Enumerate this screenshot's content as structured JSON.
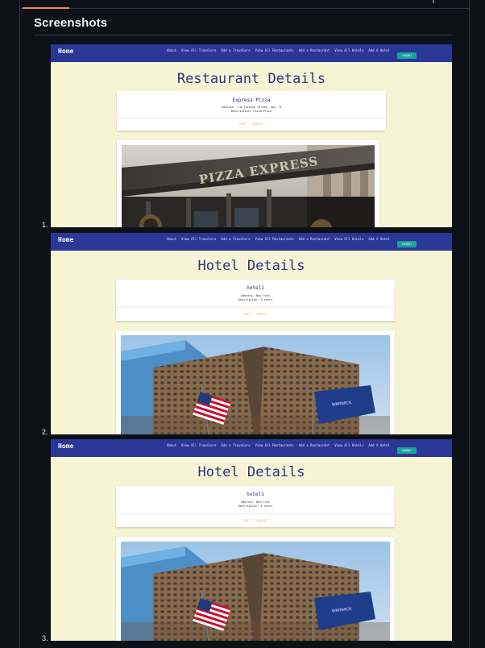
{
  "section": {
    "title": "Screenshots"
  },
  "shots": [
    {
      "number": "1.",
      "nav": {
        "home": "Home",
        "links": [
          "About",
          "View All Travelers",
          "Add a Travelers",
          "View All Restaurants",
          "Add a Restaurant",
          "View All Hotels",
          "Add A Hotel"
        ],
        "logout": "LOGOUT"
      },
      "page_title": "Restaurant Details",
      "card": {
        "name": "Express Pizza",
        "address": "Address: 1 W Jackson Street, Apt. 8",
        "description": "Description: Pizza Place",
        "edit": "EDIT",
        "delete": "DELETE"
      },
      "photo_sign": "PIZZA EXPRESS"
    },
    {
      "number": "2.",
      "nav": {
        "home": "Home",
        "links": [
          "About",
          "View All Travelers",
          "Add a Travelers",
          "View All Restaurants",
          "Add a Restaurant",
          "View All Hotels",
          "Add A Hotel"
        ],
        "logout": "LOGOUT"
      },
      "page_title": "Hotel Details",
      "card": {
        "name": "hotel1",
        "address": "Address: New York",
        "description": "Description: 3 stars",
        "edit": "EDIT",
        "delete": "DELETE"
      },
      "photo_flag_text": "WARWICK"
    },
    {
      "number": "3.",
      "nav": {
        "home": "Home",
        "links": [
          "About",
          "View All Travelers",
          "Add a Travelers",
          "View All Restaurants",
          "Add a Restaurant",
          "View All Hotels",
          "Add A Hotel"
        ],
        "logout": "LOGOUT"
      },
      "page_title": "Hotel Details",
      "card": {
        "name": "hotel1",
        "address": "Address: New York",
        "description": "Description: 3 stars",
        "edit": "EDIT",
        "delete": "DELETE"
      },
      "photo_flag_text": "WARWICK"
    }
  ]
}
